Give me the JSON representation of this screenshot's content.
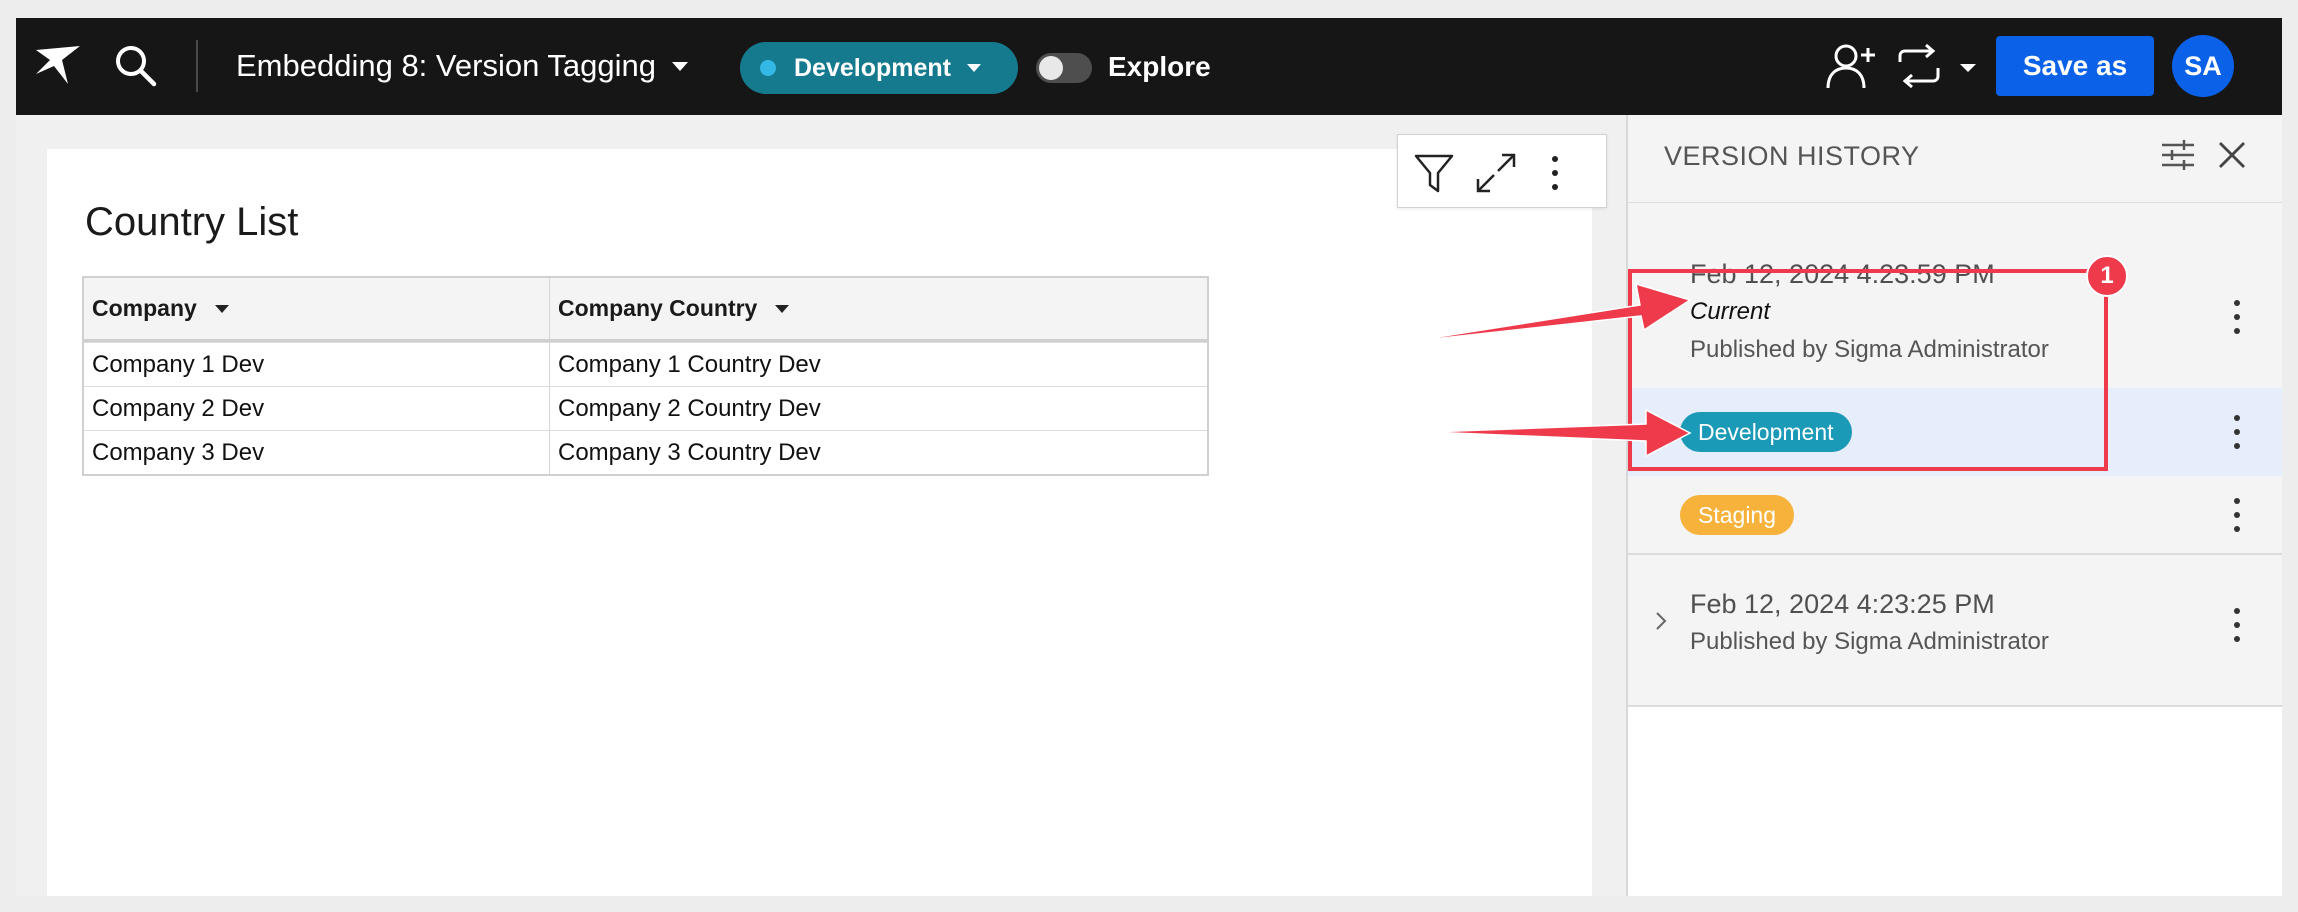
{
  "topbar": {
    "workbook_title": "Embedding 8: Version Tagging",
    "version_tag": "Development",
    "explore_label": "Explore",
    "save_label": "Save as",
    "avatar_initials": "SA",
    "colors": {
      "bar": "#161616",
      "version_pill": "#157a8e",
      "primary": "#0b62e8"
    }
  },
  "card": {
    "title": "Country List",
    "columns": [
      "Company",
      "Company Country"
    ],
    "rows": [
      [
        "Company 1 Dev",
        "Company 1 Country Dev"
      ],
      [
        "Company 2 Dev",
        "Company 2 Country Dev"
      ],
      [
        "Company 3 Dev",
        "Company 3 Country Dev"
      ]
    ]
  },
  "panel": {
    "title": "VERSION HISTORY",
    "versions": [
      {
        "date": "Feb 12, 2024 4:23:59 PM",
        "current_label": "Current",
        "published_by": "Published by Sigma Administrator",
        "tags": [
          "Development",
          "Staging"
        ]
      },
      {
        "date": "Feb 12, 2024 4:23:25 PM",
        "published_by": "Published by Sigma Administrator"
      }
    ],
    "tag_colors": {
      "Development": "#1b9ab8",
      "Staging": "#f6b23a"
    }
  },
  "annotation": {
    "badge": "1",
    "color": "#ee3a4a"
  }
}
